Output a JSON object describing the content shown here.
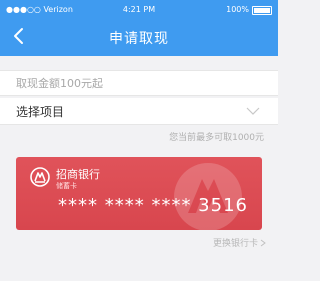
{
  "status_bar": {
    "carrier": "●●●○○ Verizon",
    "time": "4:21 PM",
    "battery": "100%"
  },
  "nav": {
    "title": "申请取现"
  },
  "form": {
    "amount_placeholder": "取现金额100元起",
    "select_label": "选择项目",
    "hint": "您当前最多可取1000元"
  },
  "card": {
    "bank_name": "招商银行",
    "card_type": "储蓄卡",
    "number": "**** **** **** 3516"
  },
  "change_card": {
    "label": "更换银行卡"
  },
  "colors": {
    "header": "#3f9bf0",
    "card": "#d8464e"
  },
  "icons": [
    "back-arrow-icon",
    "wifi-icon",
    "battery-icon",
    "chevron-down-icon",
    "bank-logo-icon",
    "chevron-right-icon"
  ]
}
